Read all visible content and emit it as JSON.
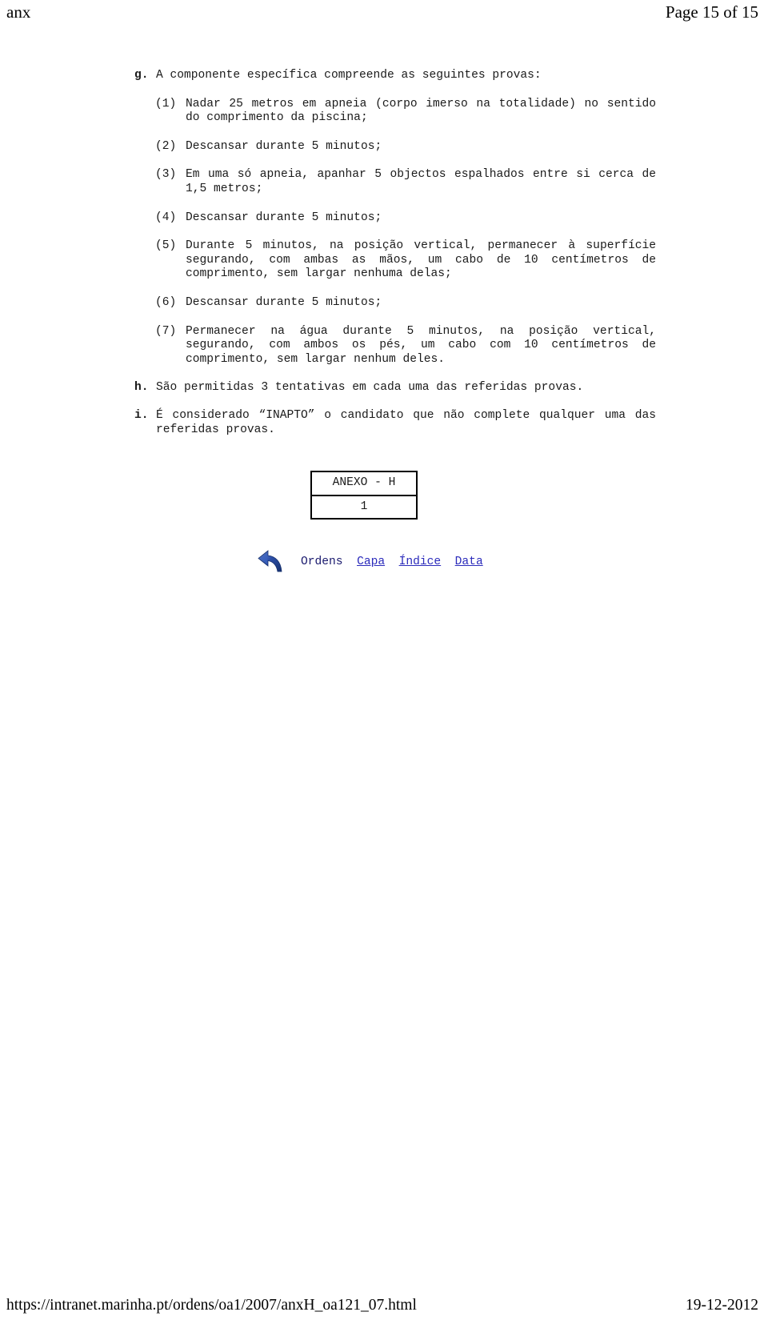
{
  "header": {
    "left_title": "anx",
    "page_indicator": "Page 15 of 15"
  },
  "document": {
    "clauses": [
      {
        "marker": "g.",
        "text": "A componente específica compreende as seguintes provas:"
      },
      {
        "marker": "(1)",
        "text": "Nadar 25 metros em apneia (corpo imerso na totalidade) no sentido do comprimento da piscina;"
      },
      {
        "marker": "(2)",
        "text": "Descansar durante 5 minutos;"
      },
      {
        "marker": "(3)",
        "text": "Em uma só apneia, apanhar 5 objectos espalhados entre si cerca de 1,5 metros;"
      },
      {
        "marker": "(4)",
        "text": "Descansar durante 5 minutos;"
      },
      {
        "marker": "(5)",
        "text": "Durante 5 minutos, na posição vertical, permanecer à superfície segurando, com ambas as mãos, um cabo de 10 centímetros de comprimento, sem largar nenhuma delas;"
      },
      {
        "marker": "(6)",
        "text": "Descansar durante 5 minutos;"
      },
      {
        "marker": "(7)",
        "text": "Permanecer na água durante 5 minutos, na posição vertical, segurando, com ambos os pés, um cabo com 10 centímetros de comprimento, sem largar nenhum deles."
      },
      {
        "marker": "h.",
        "text": "São permitidas 3 tentativas em cada uma das referidas provas."
      },
      {
        "marker": "i.",
        "text": "É considerado “INAPTO” o candidato que não complete qualquer uma das referidas provas."
      }
    ]
  },
  "anexo": {
    "title": "ANEXO - H",
    "page_number": "1"
  },
  "nav": {
    "back_icon": "back-arrow-icon",
    "items": [
      {
        "label": "Ordens",
        "link": false
      },
      {
        "label": "Capa",
        "link": true
      },
      {
        "label": "Índice",
        "link": true
      },
      {
        "label": "Data",
        "link": true
      }
    ]
  },
  "footer": {
    "url": "https://intranet.marinha.pt/ordens/oa1/2007/anxH_oa121_07.html",
    "date": "19-12-2012"
  },
  "colors": {
    "text": "#1a1a1a",
    "link": "#2b2bbb",
    "nav_plain": "#1a1a6e",
    "border": "#000000",
    "arrow_dark": "#16306e",
    "arrow_mid": "#2c4fa8",
    "arrow_light": "#7d9ad8"
  }
}
